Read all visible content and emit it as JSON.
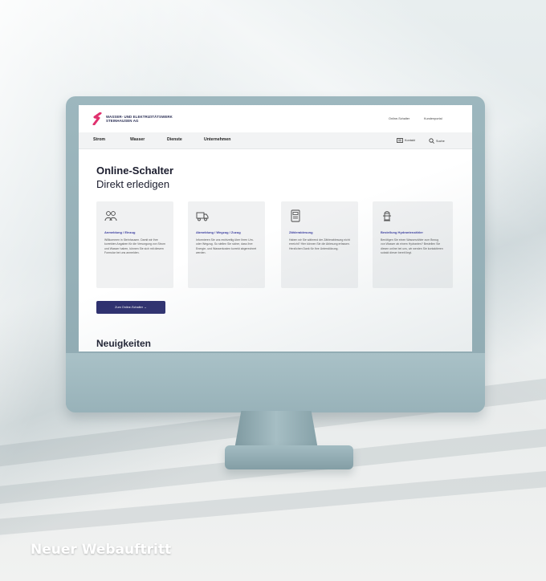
{
  "caption": "Neuer Webauftritt",
  "colors": {
    "accent": "#2d2f6e",
    "brand_red": "#e0316e",
    "link_blue": "#3c3fa0"
  },
  "site": {
    "company_name": "WASSER- UND ELEKTRIZITÄTSWERK\nSTEINHAUSEN AG",
    "top_links": [
      "Online-Schalter",
      "Kundenportal"
    ],
    "nav": [
      "Strom",
      "Wasser",
      "Dienste",
      "Unternehmen"
    ],
    "nav_right": {
      "contact": "Kontakt",
      "search": "Suche"
    },
    "hero": {
      "title": "Online-Schalter",
      "subtitle": "Direkt erledigen"
    },
    "cards": [
      {
        "icon": "people-icon",
        "title": "Anmeldung / Einzug",
        "text": "Willkommen in Steinhausen. Damit wir Ihre korrekten Angaben für die Versorgung von Strom und Wasser haben, können Sie sich mit diesem Formular bei uns anmelden."
      },
      {
        "icon": "moving-truck-icon",
        "title": "Abmeldung / Wegzug / Zuzug",
        "text": "Informieren Sie uns rechtzeitig über Ihren Um- oder Wegzug. So stellen Sie sicher, dass Ihre Energie- und Wasserkosten korrekt abgerechnet werden."
      },
      {
        "icon": "meter-icon",
        "title": "Zählerablesung",
        "text": "Haben wir Sie während der Zählerablesung nicht erreicht? Hier können Sie die Ablesung erfassen. Herzlichen Dank für Ihre Unterstützung."
      },
      {
        "icon": "hydrant-icon",
        "title": "Bestellung Hydrantenzähler",
        "text": "Benötigen Sie einen Wasserzähler zum Bezug von Wasser ab einem Hydranten? Bestellen Sie diesen online bei uns, wir werden Sie kontaktieren sobald dieser bereit liegt."
      }
    ],
    "cta_label": "Zum Online-Schalter →",
    "news_title": "Neuigkeiten"
  }
}
